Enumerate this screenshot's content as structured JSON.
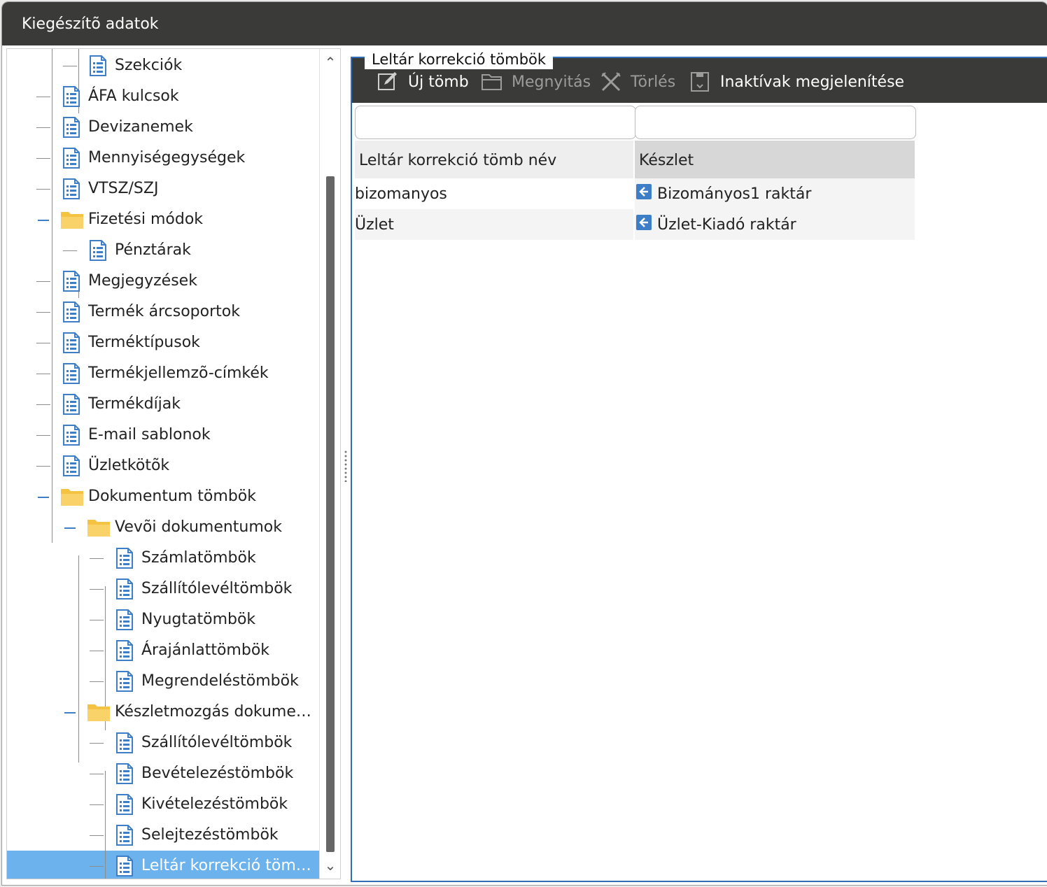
{
  "window": {
    "title": "Kiegészítõ adatok"
  },
  "tree": {
    "items": [
      {
        "label": "Szekciók",
        "type": "doc",
        "level": 2
      },
      {
        "label": "ÁFA kulcsok",
        "type": "doc",
        "level": 1
      },
      {
        "label": "Devizanemek",
        "type": "doc",
        "level": 1
      },
      {
        "label": "Mennyiségegységek",
        "type": "doc",
        "level": 1
      },
      {
        "label": "VTSZ/SZJ",
        "type": "doc",
        "level": 1
      },
      {
        "label": "Fizetési módok",
        "type": "folder",
        "level": 1,
        "expanded": true
      },
      {
        "label": "Pénztárak",
        "type": "doc",
        "level": 2
      },
      {
        "label": "Megjegyzések",
        "type": "doc",
        "level": 1
      },
      {
        "label": "Termék árcsoportok",
        "type": "doc",
        "level": 1
      },
      {
        "label": "Terméktípusok",
        "type": "doc",
        "level": 1
      },
      {
        "label": "Termékjellemzõ-címkék",
        "type": "doc",
        "level": 1
      },
      {
        "label": "Termékdíjak",
        "type": "doc",
        "level": 1
      },
      {
        "label": "E-mail sablonok",
        "type": "doc",
        "level": 1
      },
      {
        "label": "Üzletkötõk",
        "type": "doc",
        "level": 1
      },
      {
        "label": "Dokumentum tömbök",
        "type": "folder",
        "level": 1,
        "expanded": true
      },
      {
        "label": "Vevõi dokumentumok",
        "type": "folder",
        "level": 2,
        "expanded": true
      },
      {
        "label": "Számlatömbök",
        "type": "doc",
        "level": 3
      },
      {
        "label": "Szállítólevéltömbök",
        "type": "doc",
        "level": 3
      },
      {
        "label": "Nyugtatömbök",
        "type": "doc",
        "level": 3
      },
      {
        "label": "Árajánlattömbök",
        "type": "doc",
        "level": 3
      },
      {
        "label": "Megrendeléstömbök",
        "type": "doc",
        "level": 3
      },
      {
        "label": "Készletmozgás dokument...",
        "type": "folder",
        "level": 2,
        "expanded": true
      },
      {
        "label": "Szállítólevéltömbök",
        "type": "doc",
        "level": 3
      },
      {
        "label": "Bevételezéstömbök",
        "type": "doc",
        "level": 3
      },
      {
        "label": "Kivételezéstömbök",
        "type": "doc",
        "level": 3
      },
      {
        "label": "Selejtezéstömbök",
        "type": "doc",
        "level": 3
      },
      {
        "label": "Leltár korrekció tömb...",
        "type": "doc",
        "level": 3,
        "selected": true
      }
    ]
  },
  "panel": {
    "title": "Leltár korrekció tömbök",
    "toolbar": {
      "new": {
        "label": "Új tömb",
        "icon": "edit-icon",
        "enabled": true
      },
      "open": {
        "label": "Megnyitás",
        "icon": "folder-open-icon",
        "enabled": false
      },
      "delete": {
        "label": "Törlés",
        "icon": "delete-icon",
        "enabled": false
      },
      "inactive": {
        "label": "Inaktívak megjelenítése",
        "icon": "archive-icon",
        "enabled": true
      }
    },
    "filters": {
      "name_value": "",
      "stock_value": ""
    },
    "grid": {
      "columns": [
        "Leltár korrekció tömb név",
        "Készlet"
      ],
      "rows": [
        {
          "name": "bizomanyos",
          "stock": "Bizományos1 raktár"
        },
        {
          "name": "Üzlet",
          "stock": "Üzlet-Kiadó raktár"
        }
      ]
    }
  },
  "colors": {
    "titlebar": "#3a3a39",
    "selection": "#6cb2ec",
    "panel_border": "#2f6fb8",
    "icon_blue": "#3d7ec7",
    "folder_yellow": "#f5c342"
  }
}
